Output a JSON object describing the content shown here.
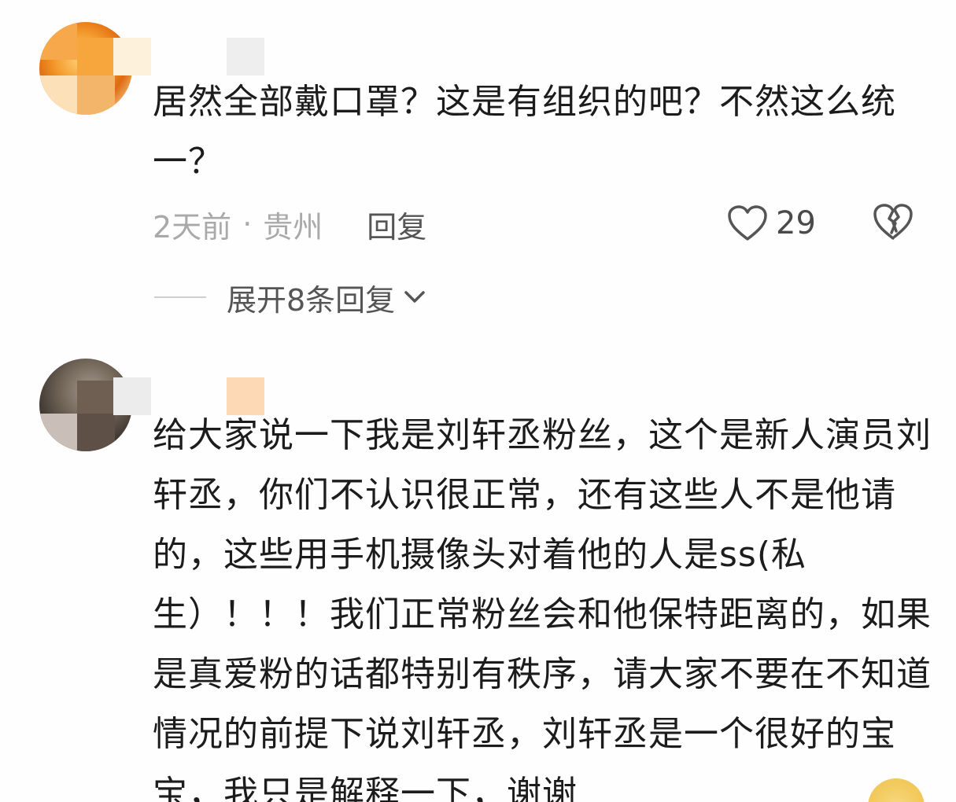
{
  "comments": [
    {
      "avatar": "avatar-flame-pixelated",
      "text": "居然全部戴口罩？这是有组织的吧？不然这么统一？",
      "meta": {
        "time": "2天前",
        "separator": "·",
        "location": "贵州",
        "reply_label": "回复"
      },
      "likes": "29",
      "expand_label": "展开8条回复"
    },
    {
      "avatar": "avatar-person-pixelated",
      "text": "给大家说一下我是刘轩丞粉丝，这个是新人演员刘轩丞，你们不认识很正常，还有这些人不是他请的，这些用手机摄像头对着他的人是ss(私生）！！！我们正常粉丝会和他保特距离的，如果是真爱粉的话都特别有秩序，请大家不要在不知道情况的前提下说刘轩丞，刘轩丞是一个很好的宝宝，我只是解释一下，谢谢"
    }
  ],
  "icons": {
    "like": "heart-outline-icon",
    "dislike": "broken-heart-icon",
    "expand": "chevron-down-icon"
  },
  "colors": {
    "text": "#1c1c1c",
    "meta": "#a9a9a9",
    "secondary": "#555555"
  }
}
